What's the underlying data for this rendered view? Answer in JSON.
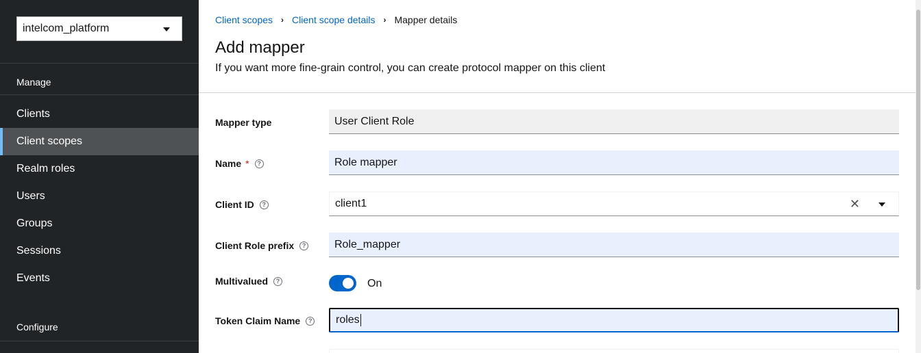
{
  "sidebar": {
    "realm": "intelcom_platform",
    "manage_title": "Manage",
    "items": [
      {
        "label": "Clients"
      },
      {
        "label": "Client scopes"
      },
      {
        "label": "Realm roles"
      },
      {
        "label": "Users"
      },
      {
        "label": "Groups"
      },
      {
        "label": "Sessions"
      },
      {
        "label": "Events"
      }
    ],
    "configure_title": "Configure"
  },
  "breadcrumb": {
    "items": [
      "Client scopes",
      "Client scope details"
    ],
    "current": "Mapper details"
  },
  "page": {
    "title": "Add mapper",
    "description": "If you want more fine-grain control, you can create protocol mapper on this client"
  },
  "form": {
    "mapper_type": {
      "label": "Mapper type",
      "value": "User Client Role"
    },
    "name": {
      "label": "Name",
      "required_mark": "*",
      "value": "Role mapper"
    },
    "client_id": {
      "label": "Client ID",
      "value": "client1",
      "clear": "✕"
    },
    "client_role_prefix": {
      "label": "Client Role prefix",
      "value": "Role_mapper"
    },
    "multivalued": {
      "label": "Multivalued",
      "state": "On",
      "on": true
    },
    "token_claim_name": {
      "label": "Token Claim Name",
      "value": "roles"
    },
    "help_glyph": "?"
  },
  "colors": {
    "sidebar_bg": "#212427",
    "active_item_bg": "#4f5255",
    "active_indicator": "#73bcf7",
    "link": "#0066cc",
    "switch_on": "#0066cc",
    "required": "#c9190b"
  }
}
